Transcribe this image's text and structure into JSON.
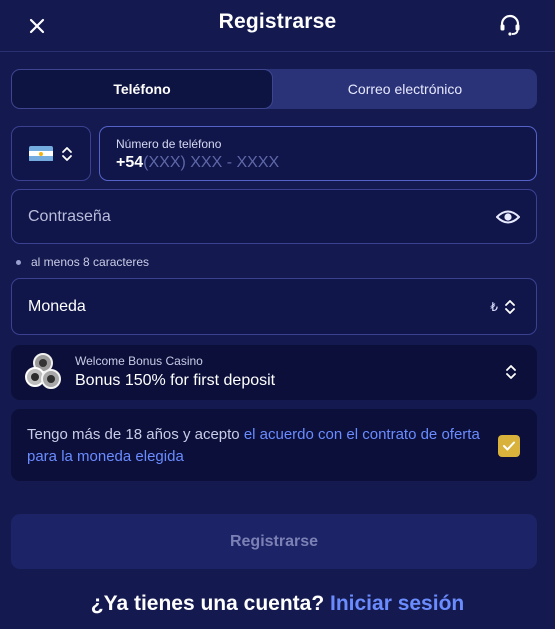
{
  "header": {
    "title": "Registrarse",
    "close_icon": "close-icon",
    "support_icon": "headset-icon"
  },
  "tabs": [
    {
      "label": "Teléfono",
      "active": true
    },
    {
      "label": "Correo electrónico",
      "active": false
    }
  ],
  "phone": {
    "country_flag": "argentina-flag-icon",
    "label": "Número de teléfono",
    "prefix": "+54",
    "placeholder": "(XXX) XXX - XXXX"
  },
  "password": {
    "placeholder": "Contraseña",
    "hint": "al menos 8 caracteres"
  },
  "currency": {
    "label": "Moneda",
    "symbol": "₺"
  },
  "bonus": {
    "title": "Welcome Bonus Casino",
    "text": "Bonus 150% for first deposit"
  },
  "terms": {
    "text": "Tengo más de 18 años y acepto ",
    "link": "el acuerdo con el contrato de oferta para la moneda elegida",
    "checked": true
  },
  "submit": {
    "label": "Registrarse"
  },
  "footer": {
    "question": "¿Ya tienes una cuenta? ",
    "login_link": "Iniciar sesión"
  },
  "colors": {
    "background": "#141a4f",
    "accent_link": "#6b8cff",
    "checkbox": "#d8b23a"
  }
}
